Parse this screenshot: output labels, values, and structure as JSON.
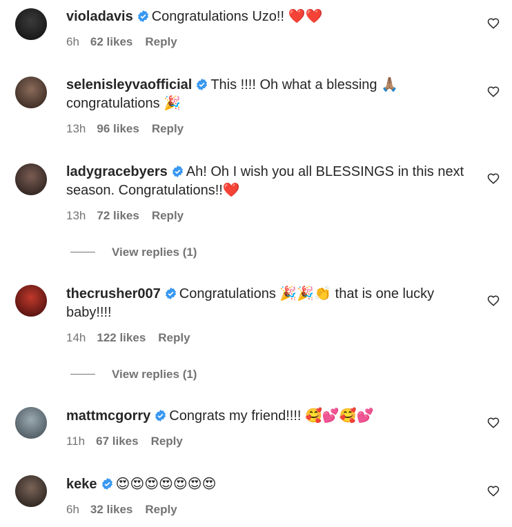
{
  "comments": [
    {
      "username": "violadavis",
      "text": "Congratulations Uzo!! ❤️❤️",
      "time": "6h",
      "likes": "62 likes",
      "reply": "Reply",
      "avatar_color": "#1a1a1a"
    },
    {
      "username": "selenisleyvaofficial",
      "text": "This !!!! Oh what a blessing 🙏🏽 congratulations 🎉",
      "time": "13h",
      "likes": "96 likes",
      "reply": "Reply",
      "avatar_color": "#4a3a34"
    },
    {
      "username": "ladygracebyers",
      "text": "Ah! Oh I wish you all BLESSINGS in this next season. Congratulations!!❤️",
      "time": "13h",
      "likes": "72 likes",
      "reply": "Reply",
      "avatar_color": "#3b2f2c",
      "view_replies": "View replies (1)"
    },
    {
      "username": "thecrusher007",
      "text": "Congratulations 🎉🎉👏 that is one lucky baby!!!!",
      "time": "14h",
      "likes": "122 likes",
      "reply": "Reply",
      "avatar_color": "#8c1c1c",
      "view_replies": "View replies (1)"
    },
    {
      "username": "mattmcgorry",
      "text": "Congrats my friend!!!! 🥰💕🥰💕",
      "time": "11h",
      "likes": "67 likes",
      "reply": "Reply",
      "avatar_color": "#6d7f8a"
    },
    {
      "username": "keke",
      "text": "😍😍😍😍😍😍😍",
      "time": "6h",
      "likes": "32 likes",
      "reply": "Reply",
      "avatar_color": "#2e2a28"
    }
  ],
  "colors": {
    "text": "#262626",
    "muted": "#737373",
    "verified": "#3897f0"
  },
  "icons": {
    "verified": "verified-badge-icon",
    "like": "heart-outline-icon"
  }
}
